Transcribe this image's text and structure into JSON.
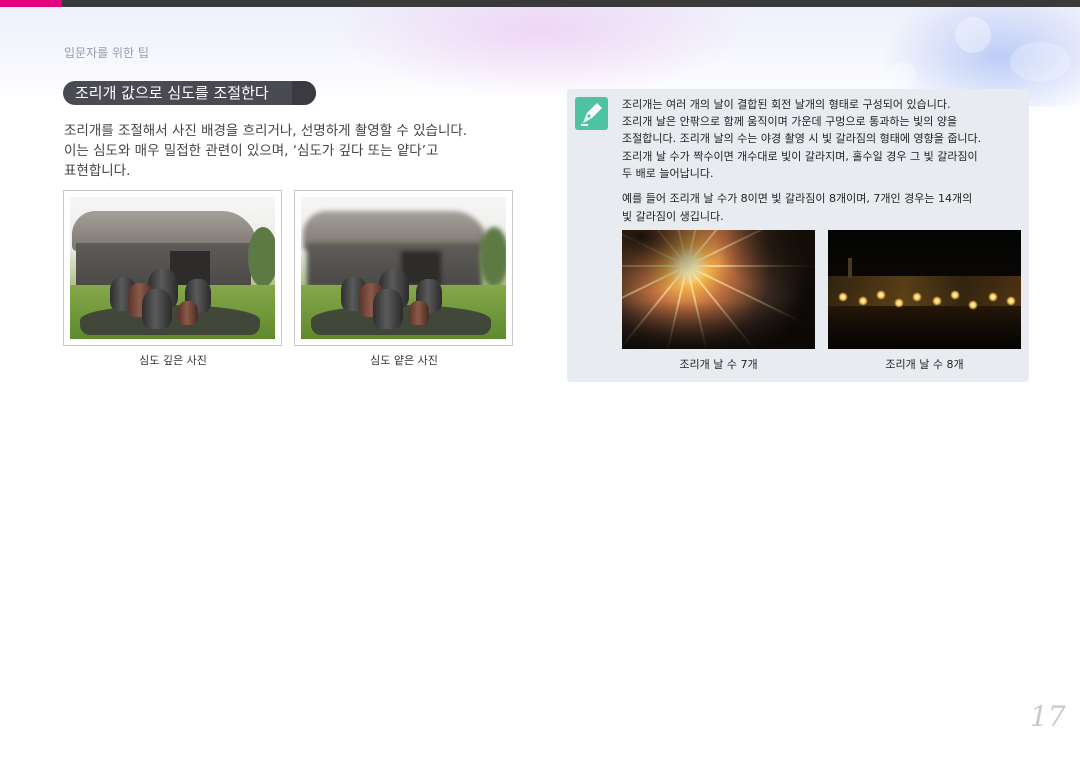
{
  "breadcrumb": "입문자를 위한 팁",
  "heading": "조리개 값으로 심도를 조절한다",
  "intro": [
    "조리개를 조절해서 사진 배경을 흐리거나, 선명하게 촬영할 수 있습니다.",
    "이는 심도와 매우 밀접한 관련이 있으며, ‘심도가 깊다 또는 얕다’고",
    "표현합니다."
  ],
  "photos": [
    {
      "caption": "심도 깊은 사진"
    },
    {
      "caption": "심도 얕은 사진"
    }
  ],
  "note": {
    "icon": "pen-note-icon",
    "paragraph1": [
      "조리개는 여러 개의 날이 결합된 회전 날개의 형태로 구성되어 있습니다.",
      "조리개 날은 안팎으로 함께 움직이며 가운데 구멍으로 통과하는 빛의 양을",
      "조절합니다. 조리개 날의 수는 야경 촬영 시 빛 갈라짐의 형태에 영향을 줍니다.",
      "조리개 날 수가 짝수이면 개수대로 빛이 갈라지며, 홀수일 경우 그 빛 갈라짐이",
      "두 배로 늘어납니다."
    ],
    "paragraph2": [
      "예를 들어 조리개 날 수가 8이면 빛 갈라짐이 8개이며, 7개인 경우는 14개의",
      "빛 갈라짐이 생깁니다."
    ],
    "images": [
      {
        "caption": "조리개 날 수 7개"
      },
      {
        "caption": "조리개 날 수 8개"
      }
    ]
  },
  "page_number": "17",
  "colors": {
    "accent": "#e5007e",
    "heading_bg": "#4a4a52",
    "note_bg": "#e8ebef",
    "note_icon": "#4fc3a1"
  }
}
